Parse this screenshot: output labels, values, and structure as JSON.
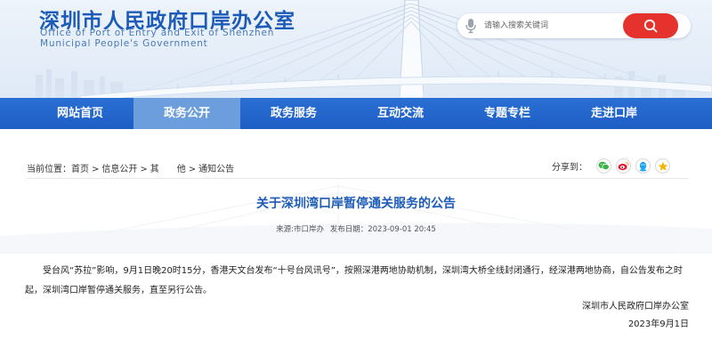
{
  "header": {
    "title_cn": "深圳市人民政府口岸办公室",
    "title_en_line1": "Office of Port of Entry and Exit of Shenzhen",
    "title_en_line2": "Municipal People's Government"
  },
  "search": {
    "placeholder": "请输入搜索关键词"
  },
  "nav": {
    "items": [
      {
        "label": "网站首页",
        "active": false
      },
      {
        "label": "政务公开",
        "active": true
      },
      {
        "label": "政务服务",
        "active": false
      },
      {
        "label": "互动交流",
        "active": false
      },
      {
        "label": "专题专栏",
        "active": false
      },
      {
        "label": "走进口岸",
        "active": false
      }
    ]
  },
  "breadcrumb": {
    "prefix": "当前位置：",
    "items": [
      "首页",
      "信息公开",
      "其　　他",
      "通知公告"
    ],
    "separator": ">"
  },
  "share": {
    "label": "分享到：",
    "icons": [
      "wechat-icon",
      "weibo-icon",
      "qq-icon",
      "qzone-icon"
    ]
  },
  "article": {
    "title": "关于深圳湾口岸暂停通关服务的公告",
    "source": "来源:市口岸办",
    "date": "发布日期：2023-09-01 20:45",
    "body": "受台风“苏拉”影响，9月1日晚20时15分，香港天文台发布“十号台风讯号”，按照深港两地协助机制，深圳湾大桥全线封闭通行，经深港两地协商，自公告发布之时起，深圳湾口岸暂停通关服务，直至另行公告。",
    "signature_org": "深圳市人民政府口岸办公室",
    "signature_date": "2023年9月1日"
  },
  "colors": {
    "brand_blue": "#1d5bb8",
    "nav_blue": "#2a6fd4",
    "nav_active": "#6c9ede",
    "search_red": "#e5322d"
  }
}
